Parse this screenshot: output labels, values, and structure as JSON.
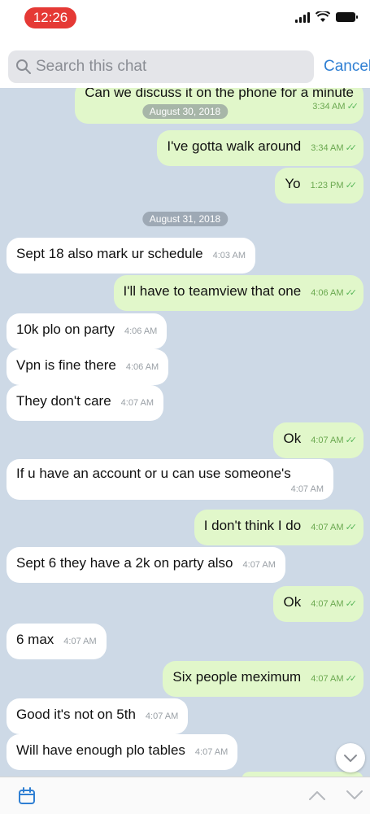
{
  "status_bar": {
    "time": "12:26"
  },
  "search": {
    "placeholder": "Search this chat",
    "cancel_label": "Cancel"
  },
  "messages": [
    {
      "text": "Can we discuss it on the phone for a minute",
      "time": "3:34 AM"
    },
    {
      "text": "I've gotta walk around",
      "time": "3:34 AM"
    },
    {
      "text": "Yo",
      "time": "1:23 PM"
    },
    {
      "text": "Sept 18 also mark ur schedule",
      "time": "4:03 AM"
    },
    {
      "text": "I'll have to teamview that one",
      "time": "4:06 AM"
    },
    {
      "text": "10k plo on party",
      "time": "4:06 AM"
    },
    {
      "text": "Vpn is fine there",
      "time": "4:06 AM"
    },
    {
      "text": "They don't care",
      "time": "4:07 AM"
    },
    {
      "text": "Ok",
      "time": "4:07 AM"
    },
    {
      "text": "If u have an account or u can use someone's",
      "time": "4:07 AM"
    },
    {
      "text": "I don't think I do",
      "time": "4:07 AM"
    },
    {
      "text": "Sept 6 they have a 2k on party also",
      "time": "4:07 AM"
    },
    {
      "text": "Ok",
      "time": "4:07 AM"
    },
    {
      "text": "6 max",
      "time": "4:07 AM"
    },
    {
      "text": "Six people meximum",
      "time": "4:07 AM"
    },
    {
      "text": "Good it's not on 5th",
      "time": "4:07 AM"
    },
    {
      "text": "Will have enough plo tables",
      "time": "4:07 AM"
    }
  ],
  "dates": [
    "August 30, 2018",
    "August 31, 2018"
  ],
  "colors": {
    "incoming_bubble": "#ffffff",
    "outgoing_bubble": "#e1f7ca",
    "chat_background": "#cdd9e6",
    "accent": "#2f7fd3",
    "time_pill": "#e53935"
  },
  "icons": {
    "search": "search-icon",
    "calendar": "calendar-icon",
    "chevron_up": "chevron-up-icon",
    "chevron_down": "chevron-down-icon",
    "read_check": "double-check-icon"
  }
}
